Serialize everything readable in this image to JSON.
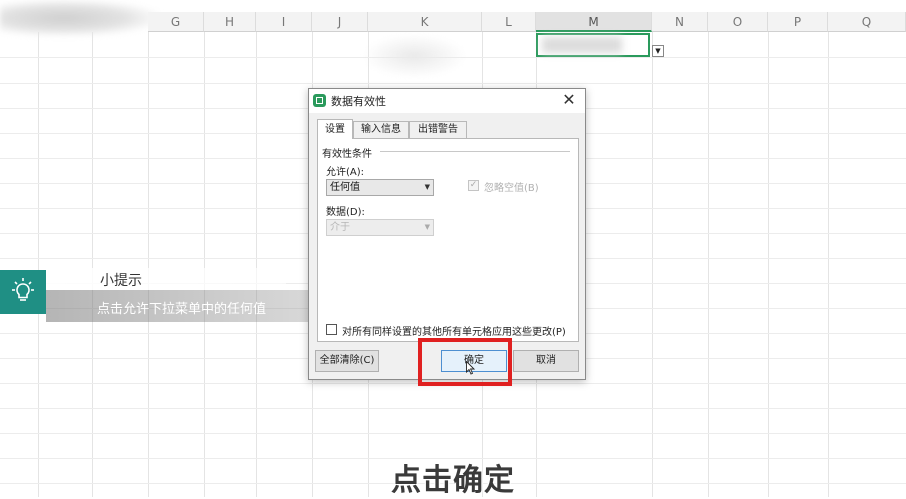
{
  "sheet": {
    "columns": [
      "G",
      "H",
      "I",
      "J",
      "K",
      "L",
      "M",
      "N",
      "O",
      "P",
      "Q"
    ],
    "active_column": "M"
  },
  "dialog": {
    "title": "数据有效性",
    "close_glyph": "✕",
    "tabs": [
      {
        "label": "设置",
        "active": true
      },
      {
        "label": "输入信息",
        "active": false
      },
      {
        "label": "出错警告",
        "active": false
      }
    ],
    "group_label": "有效性条件",
    "allow_label": "允许(A):",
    "allow_value": "任何值",
    "ignore_blank_label": "忽略空值(B)",
    "data_label": "数据(D):",
    "data_value": "介于",
    "apply_all_label": "对所有同样设置的其他所有单元格应用这些更改(P)",
    "clear_all_label": "全部清除(C)",
    "ok_label": "确定",
    "cancel_label": "取消"
  },
  "tip": {
    "title": "小提示",
    "body": "点击允许下拉菜单中的任何值",
    "accent_color": "#1f8f84",
    "icon": "lightbulb-icon"
  },
  "subtitle": "点击确定",
  "colors": {
    "highlight": "#e02020",
    "selection": "#2a9a5c"
  }
}
